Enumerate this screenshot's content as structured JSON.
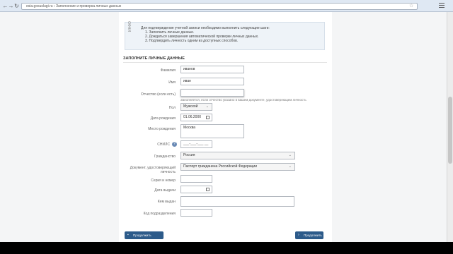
{
  "browser": {
    "back": "←",
    "forward": "→",
    "refresh": "↻",
    "address": "esia.gosuslugi.ru › Заполнение и проверка личных данных"
  },
  "info": {
    "side_label": "ИНФО",
    "lines": [
      "Для подтверждения учетной записи необходимо выполнить следующие шаги:",
      "1.   Заполнить личные данные.",
      "2.   Дождаться завершения автоматической проверки личных данных.",
      "3.   Подтвердить личность одним из доступных способов."
    ]
  },
  "section": {
    "title": "ЗАПОЛНИТЕ ЛИЧНЫЕ ДАННЫЕ"
  },
  "form": {
    "last_name": {
      "label": "Фамилия",
      "value": "иванов"
    },
    "first_name": {
      "label": "Имя",
      "value": "иван"
    },
    "patronymic": {
      "label": "Отчество (если есть)",
      "value": "",
      "hint": "Заполняется, если отчество указано в вашем документе, удостоверяющем личность"
    },
    "gender": {
      "label": "Пол",
      "value": "Мужской"
    },
    "birth_date": {
      "label": "Дата рождения",
      "value": "01.06.2000"
    },
    "birth_place": {
      "label": "Место рождения",
      "value": "Москва"
    },
    "snils": {
      "label": "СНИЛС",
      "value": "___-___-___ __",
      "help": "?"
    },
    "citizenship": {
      "label": "Гражданство",
      "value": "Россия"
    },
    "doc_type": {
      "label": "Документ, удостоверяющий личность",
      "value": "Паспорт гражданина Российской Федерации"
    },
    "series_number": {
      "label": "Серия и номер",
      "value": ""
    },
    "issue_date": {
      "label": "Дата выдачи",
      "value": ""
    },
    "issued_by": {
      "label": "Кем выдан",
      "value": ""
    },
    "division_code": {
      "label": "Код подразделения",
      "value": ""
    }
  },
  "buttons": {
    "later": "Продолжить позже",
    "continue": "Продолжить"
  }
}
